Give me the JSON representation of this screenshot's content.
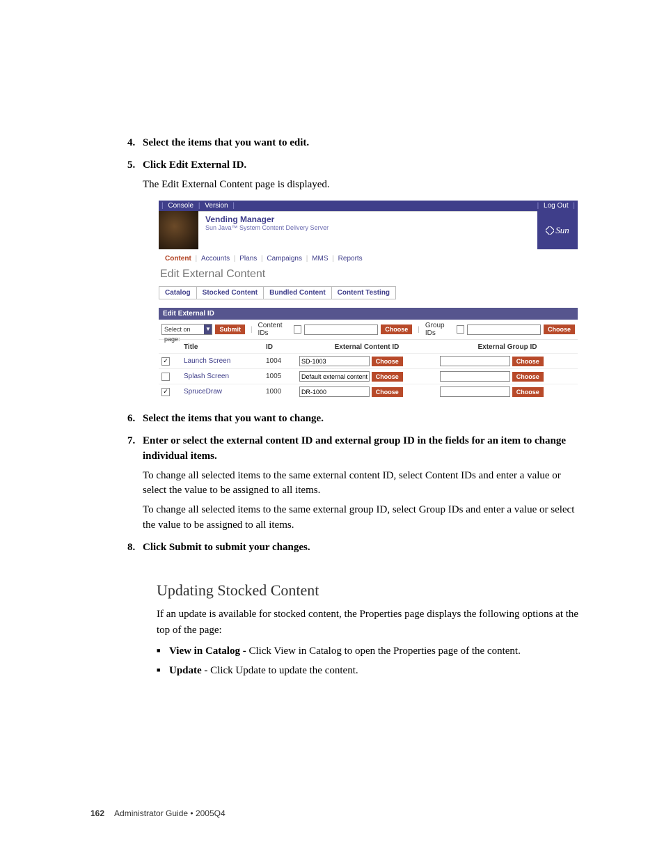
{
  "steps_a": [
    {
      "num": "4.",
      "title": "Select the items that you want to edit."
    },
    {
      "num": "5.",
      "title": "Click Edit External ID.",
      "body": [
        "The Edit External Content page is displayed."
      ]
    }
  ],
  "screenshot": {
    "topbar": {
      "console": "Console",
      "version": "Version",
      "logout": "Log Out"
    },
    "header": {
      "title": "Vending Manager",
      "subtitle": "Sun Java™ System Content Delivery Server",
      "sun": "Sun"
    },
    "nav": [
      "Content",
      "Accounts",
      "Plans",
      "Campaigns",
      "MMS",
      "Reports"
    ],
    "page_title": "Edit External Content",
    "tabs": [
      "Catalog",
      "Stocked Content",
      "Bundled Content",
      "Content Testing"
    ],
    "section": "Edit External ID",
    "bar": {
      "select_label": "Select on page:",
      "submit": "Submit",
      "content_ids": "Content IDs",
      "group_ids": "Group IDs",
      "choose": "Choose"
    },
    "columns": [
      "",
      "Title",
      "ID",
      "External Content ID",
      "External Group ID"
    ],
    "rows": [
      {
        "checked": true,
        "title": "Launch Screen",
        "id": "1004",
        "ext_content": "SD-1003",
        "ext_group": ""
      },
      {
        "checked": false,
        "title": "Splash Screen",
        "id": "1005",
        "ext_content": "Default external content",
        "ext_group": ""
      },
      {
        "checked": true,
        "title": "SpruceDraw",
        "id": "1000",
        "ext_content": "DR-1000",
        "ext_group": ""
      }
    ],
    "choose": "Choose"
  },
  "steps_b": [
    {
      "num": "6.",
      "title": "Select the items that you want to change."
    },
    {
      "num": "7.",
      "title": "Enter or select the external content ID and external group ID in the fields for an item to change individual items.",
      "body": [
        "To change all selected items to the same external content ID, select Content IDs and enter a value or select the value to be assigned to all items.",
        "To change all selected items to the same external group ID, select Group IDs and enter a value or select the value to be assigned to all items."
      ]
    },
    {
      "num": "8.",
      "title": "Click Submit to submit your changes."
    }
  ],
  "section_heading": "Updating Stocked Content",
  "section_intro": "If an update is available for stocked content, the Properties page displays the following options at the top of the page:",
  "bullets": [
    {
      "bold": "View in Catalog - ",
      "text": "Click View in Catalog to open the Properties page of the content."
    },
    {
      "bold": "Update - ",
      "text": "Click Update to update the content."
    }
  ],
  "footer": {
    "page": "162",
    "text": "Administrator Guide  •  2005Q4"
  }
}
